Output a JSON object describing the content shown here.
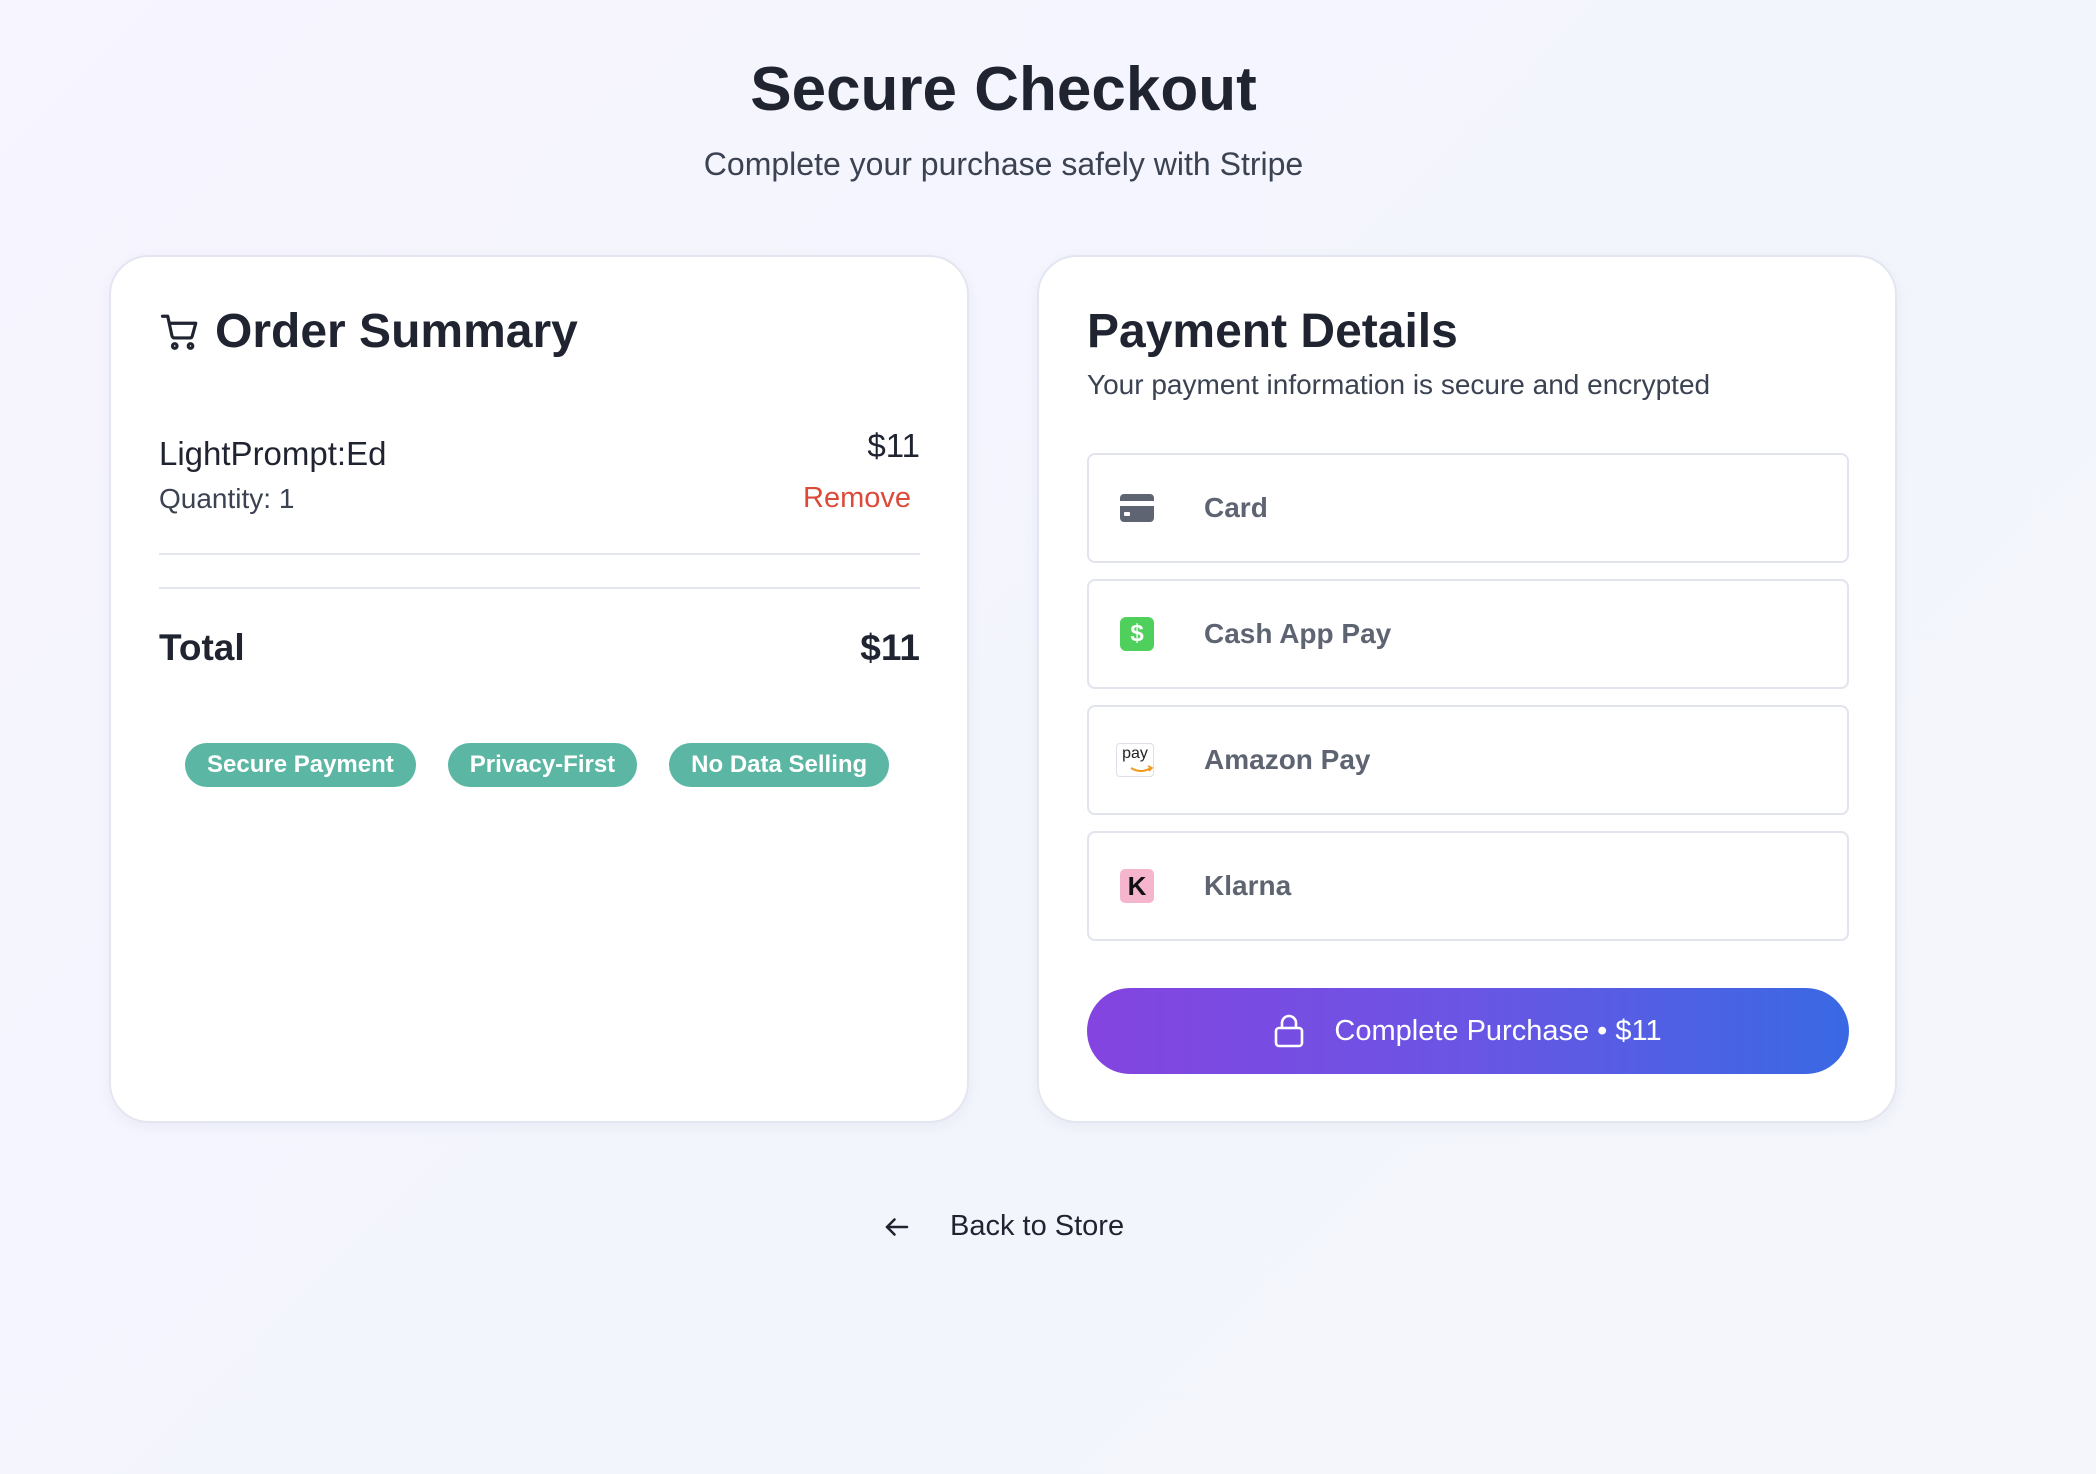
{
  "header": {
    "title": "Secure Checkout",
    "subtitle": "Complete your purchase safely with Stripe"
  },
  "order_summary": {
    "title": "Order Summary",
    "icon": "cart-icon",
    "item": {
      "name": "LightPrompt:Ed",
      "price": "$11",
      "quantity": "Quantity: 1",
      "remove_label": "Remove"
    },
    "total_label": "Total",
    "total_value": "$11",
    "badges": [
      "Secure Payment",
      "Privacy-First",
      "No Data Selling"
    ]
  },
  "payment": {
    "title": "Payment Details",
    "subtitle": "Your payment information is secure and encrypted",
    "options": [
      {
        "label": "Card",
        "icon": "card-icon"
      },
      {
        "label": "Cash App Pay",
        "icon": "cashapp-icon",
        "glyph": "$"
      },
      {
        "label": "Amazon Pay",
        "icon": "amazon-pay-icon",
        "glyph": "pay"
      },
      {
        "label": "Klarna",
        "icon": "klarna-icon",
        "glyph": "K"
      }
    ],
    "submit_label": "Complete Purchase • $11"
  },
  "footer": {
    "back_label": "Back to Store"
  },
  "colors": {
    "accent_start": "#8444e0",
    "accent_end": "#3969e4",
    "badge": "#5bb7a3",
    "remove": "#dc4a3a",
    "cashapp": "#4fcf5c",
    "klarna": "#f5b5cd"
  }
}
